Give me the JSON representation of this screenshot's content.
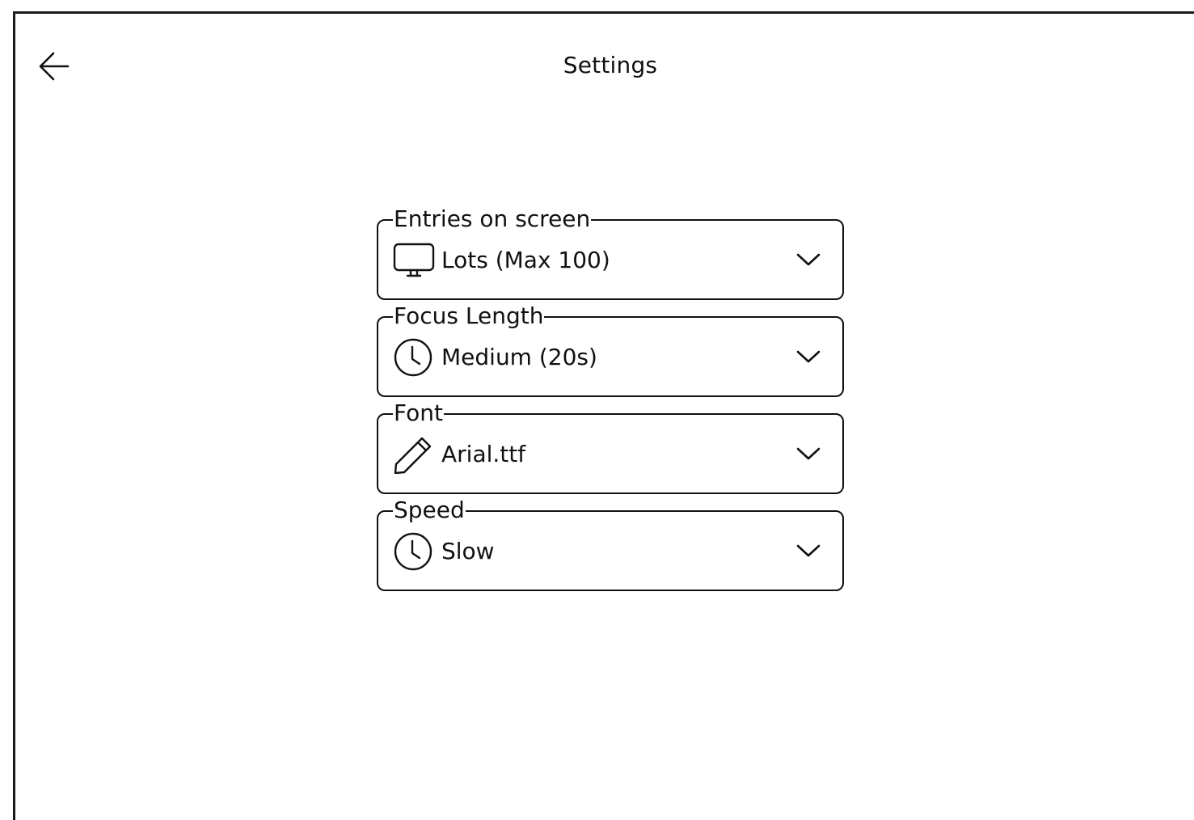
{
  "header": {
    "title": "Settings",
    "back_icon": "arrow-left-icon"
  },
  "settings": [
    {
      "label": "Entries on screen",
      "value": "Lots (Max 100)",
      "icon": "monitor-icon"
    },
    {
      "label": "Focus Length",
      "value": "Medium (20s)",
      "icon": "clock-icon"
    },
    {
      "label": "Font",
      "value": "Arial.ttf",
      "icon": "pencil-icon"
    },
    {
      "label": "Speed",
      "value": "Slow",
      "icon": "clock-icon"
    }
  ],
  "colors": {
    "stroke": "#111111",
    "background": "#ffffff"
  }
}
